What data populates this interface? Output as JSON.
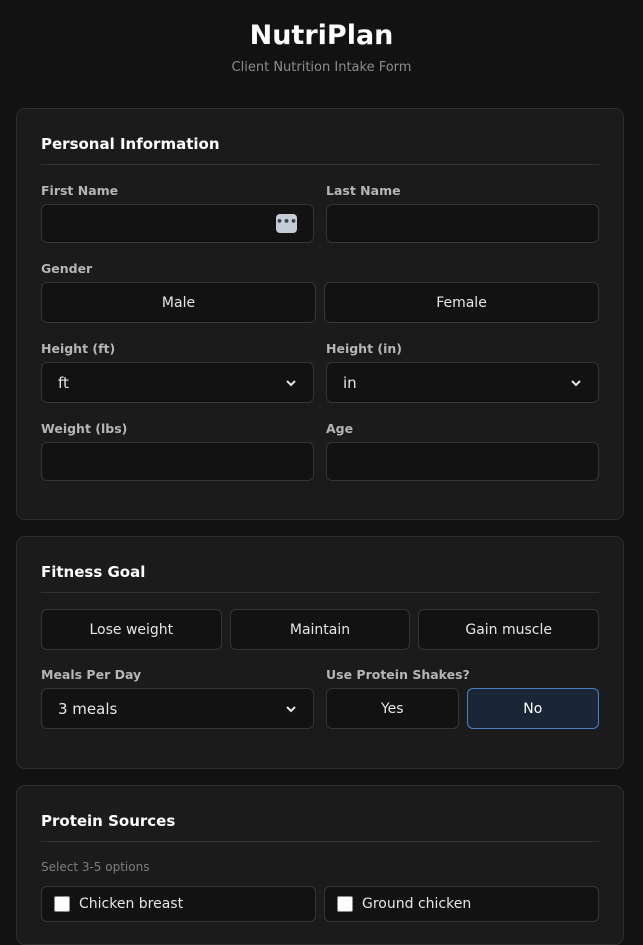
{
  "app": {
    "title": "NutriPlan",
    "subtitle": "Client Nutrition Intake Form"
  },
  "personal": {
    "title": "Personal Information",
    "first_name_label": "First Name",
    "last_name_label": "Last Name",
    "gender_label": "Gender",
    "gender_options": [
      "Male",
      "Female"
    ],
    "height_ft_label": "Height (ft)",
    "height_ft_value": "ft",
    "height_in_label": "Height (in)",
    "height_in_value": "in",
    "weight_label": "Weight (lbs)",
    "age_label": "Age"
  },
  "goal": {
    "title": "Fitness Goal",
    "options": [
      "Lose weight",
      "Maintain",
      "Gain muscle"
    ],
    "meals_label": "Meals Per Day",
    "meals_value": "3 meals",
    "shakes_label": "Use Protein Shakes?",
    "shakes_options": [
      "Yes",
      "No"
    ],
    "shakes_selected": "No"
  },
  "protein": {
    "title": "Protein Sources",
    "hint": "Select 3-5 options",
    "options": [
      "Chicken breast",
      "Ground chicken"
    ]
  },
  "icons": {
    "autofill": "more-dots-icon",
    "dropdown": "chevron-down-icon",
    "check": "checkbox-icon"
  },
  "colors": {
    "background": "#121212",
    "card": "#1b1b1b",
    "accent": "#4a7fbf"
  }
}
